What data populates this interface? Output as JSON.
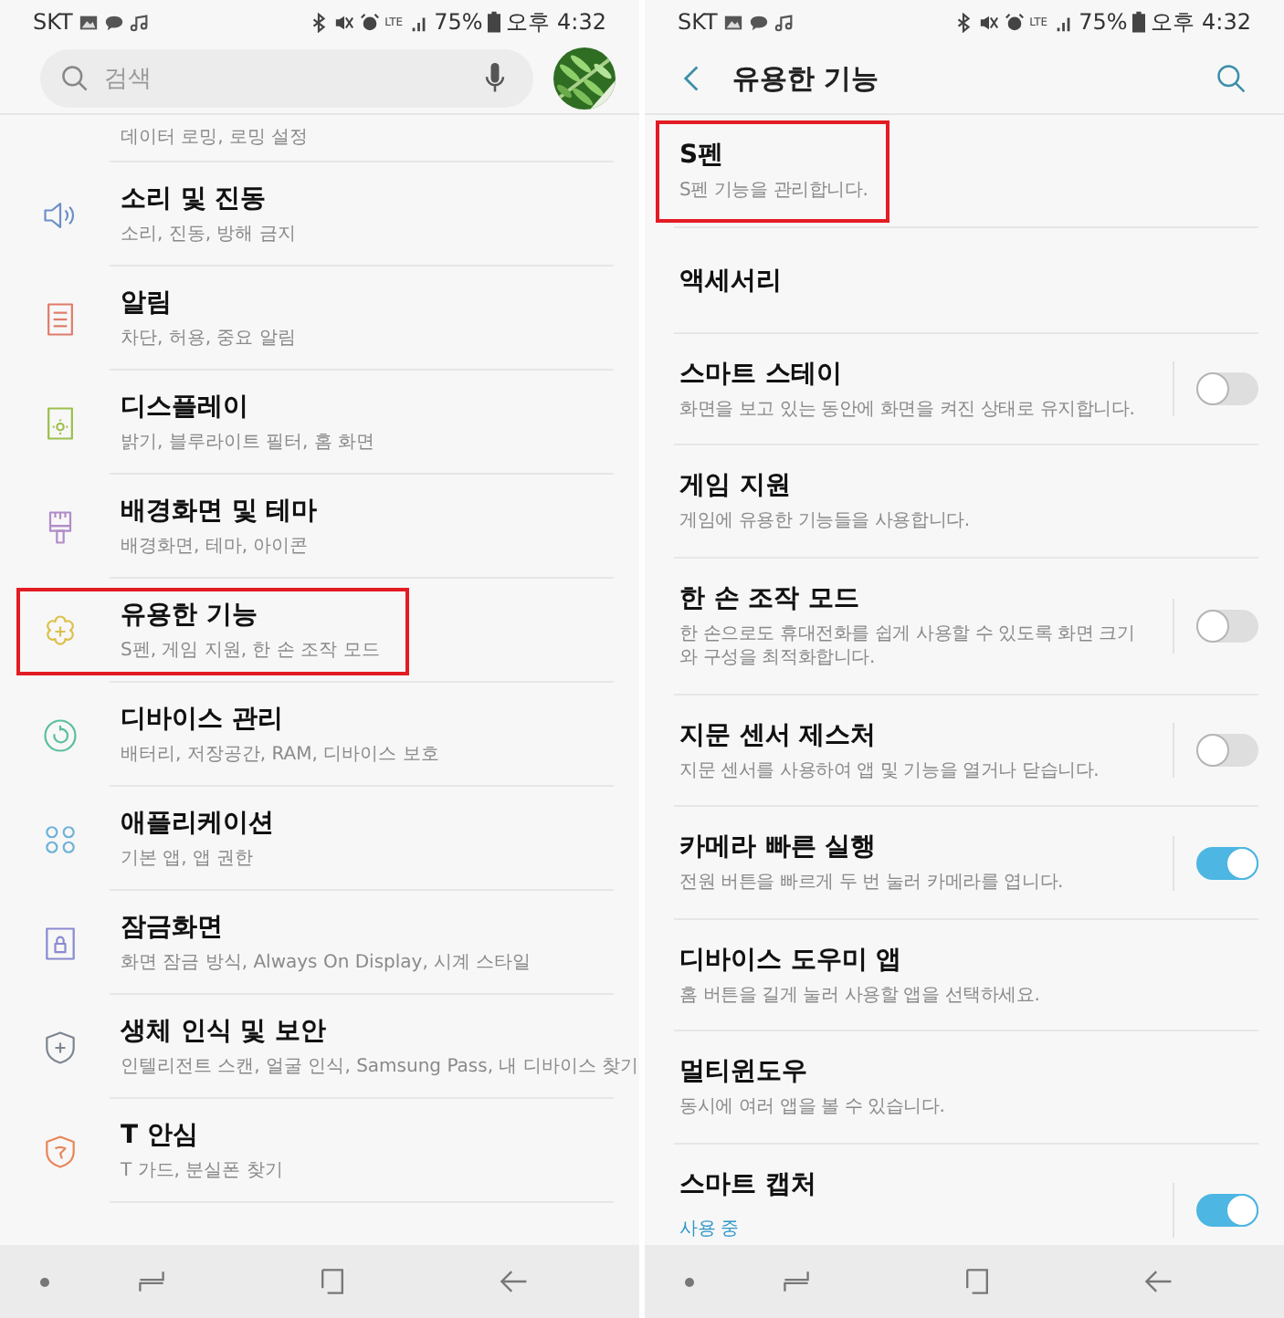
{
  "panels": [
    {
      "kind": "settings-list",
      "status_bar": {
        "carrier": "SKT",
        "network": "LTE",
        "battery": "75%",
        "time": "오후 4:32"
      },
      "search": {
        "placeholder": "검색"
      },
      "items": [
        {
          "kind": "cut-top",
          "subtitle": "데이터 로밍, 로밍 설정"
        },
        {
          "kind": "row",
          "title": "소리 및 진동",
          "subtitle": "소리, 진동, 방해 금지",
          "highlighted": false
        },
        {
          "kind": "row",
          "title": "알림",
          "subtitle": "차단, 허용, 중요 알림",
          "highlighted": false
        },
        {
          "kind": "row",
          "title": "디스플레이",
          "subtitle": "밝기, 블루라이트 필터, 홈 화면",
          "highlighted": false
        },
        {
          "kind": "row",
          "title": "배경화면 및 테마",
          "subtitle": "배경화면, 테마, 아이콘",
          "highlighted": false
        },
        {
          "kind": "row",
          "title": "유용한 기능",
          "subtitle": "S펜, 게임 지원, 한 손 조작 모드",
          "highlighted": true
        },
        {
          "kind": "row",
          "title": "디바이스 관리",
          "subtitle": "배터리, 저장공간, RAM, 디바이스 보호",
          "highlighted": false
        },
        {
          "kind": "row",
          "title": "애플리케이션",
          "subtitle": "기본 앱, 앱 권한",
          "highlighted": false
        },
        {
          "kind": "row",
          "title": "잠금화면",
          "subtitle": "화면 잠금 방식, Always On Display, 시계 스타일",
          "highlighted": false
        },
        {
          "kind": "row",
          "title": "생체 인식 및 보안",
          "subtitle": "인텔리전트 스캔, 얼굴 인식, Samsung Pass, 내 디바이스 찾기",
          "highlighted": false
        },
        {
          "kind": "row",
          "title": "T 안심",
          "subtitle": "T 가드, 분실폰 찾기",
          "highlighted": false
        }
      ]
    },
    {
      "kind": "feature-list",
      "status_bar": {
        "carrier": "SKT",
        "network": "LTE",
        "battery": "75%",
        "time": "오후 4:32"
      },
      "header": {
        "title": "유용한 기능"
      },
      "items": [
        {
          "kind": "plain",
          "title": "S펜",
          "subtitle": "S펜 기능을 관리합니다.",
          "highlighted": true
        },
        {
          "kind": "plain",
          "title": "액세서리",
          "highlighted": false
        },
        {
          "kind": "toggle",
          "title": "스마트 스테이",
          "subtitle": "화면을 보고 있는 동안에 화면을 켜진 상태로 유지합니다.",
          "on": false,
          "highlighted": false
        },
        {
          "kind": "plain",
          "title": "게임 지원",
          "subtitle": "게임에 유용한 기능들을 사용합니다.",
          "highlighted": false
        },
        {
          "kind": "toggle",
          "title": "한 손 조작 모드",
          "subtitle": "한 손으로도 휴대전화를 쉽게 사용할 수 있도록 화면 크기와 구성을 최적화합니다.",
          "on": false,
          "highlighted": false
        },
        {
          "kind": "toggle",
          "title": "지문 센서 제스처",
          "subtitle": "지문 센서를 사용하여 앱 및 기능을 열거나 닫습니다.",
          "on": false,
          "highlighted": false
        },
        {
          "kind": "toggle",
          "title": "카메라 빠른 실행",
          "subtitle": "전원 버튼을 빠르게 두 번 눌러 카메라를 엽니다.",
          "on": true,
          "highlighted": false
        },
        {
          "kind": "plain",
          "title": "디바이스 도우미 앱",
          "subtitle": "홈 버튼을 길게 눌러 사용할 앱을 선택하세요.",
          "highlighted": false
        },
        {
          "kind": "plain",
          "title": "멀티윈도우",
          "subtitle": "동시에 여러 앱을 볼 수 있습니다.",
          "highlighted": false
        },
        {
          "kind": "toggle-status",
          "title": "스마트 캡처",
          "subtitle": "사용 중",
          "on": true,
          "highlighted": false
        }
      ]
    }
  ]
}
